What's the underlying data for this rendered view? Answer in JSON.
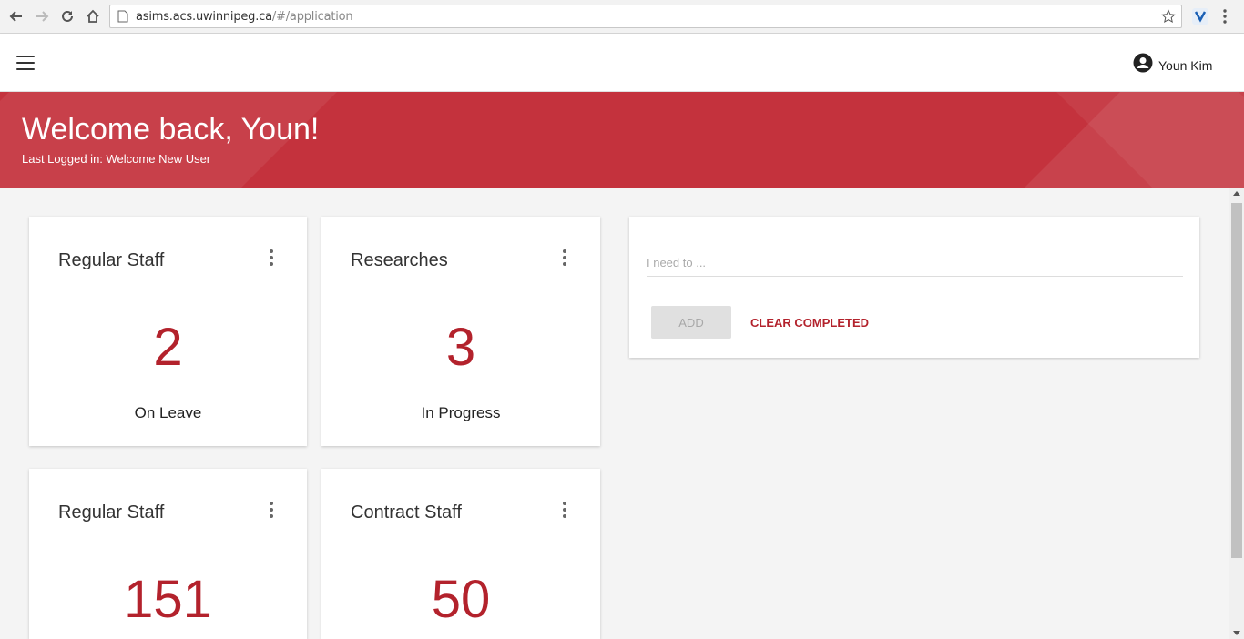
{
  "browser": {
    "url_host": "asims.acs.uwinnipeg.ca",
    "url_path": "/#/application"
  },
  "appbar": {
    "user_name": "Youn Kim"
  },
  "hero": {
    "title": "Welcome back, Youn!",
    "subtitle": "Last Logged in: Welcome New User"
  },
  "cards": [
    {
      "title": "Regular Staff",
      "value": "2",
      "label": "On Leave"
    },
    {
      "title": "Researches",
      "value": "3",
      "label": "In Progress"
    },
    {
      "title": "Regular Staff",
      "value": "151",
      "label": ""
    },
    {
      "title": "Contract Staff",
      "value": "50",
      "label": ""
    }
  ],
  "todo": {
    "placeholder": "I need to ...",
    "value": "",
    "add_label": "ADD",
    "clear_label": "CLEAR COMPLETED"
  },
  "colors": {
    "brand_red": "#c4323d",
    "value_red": "#b3222c"
  }
}
